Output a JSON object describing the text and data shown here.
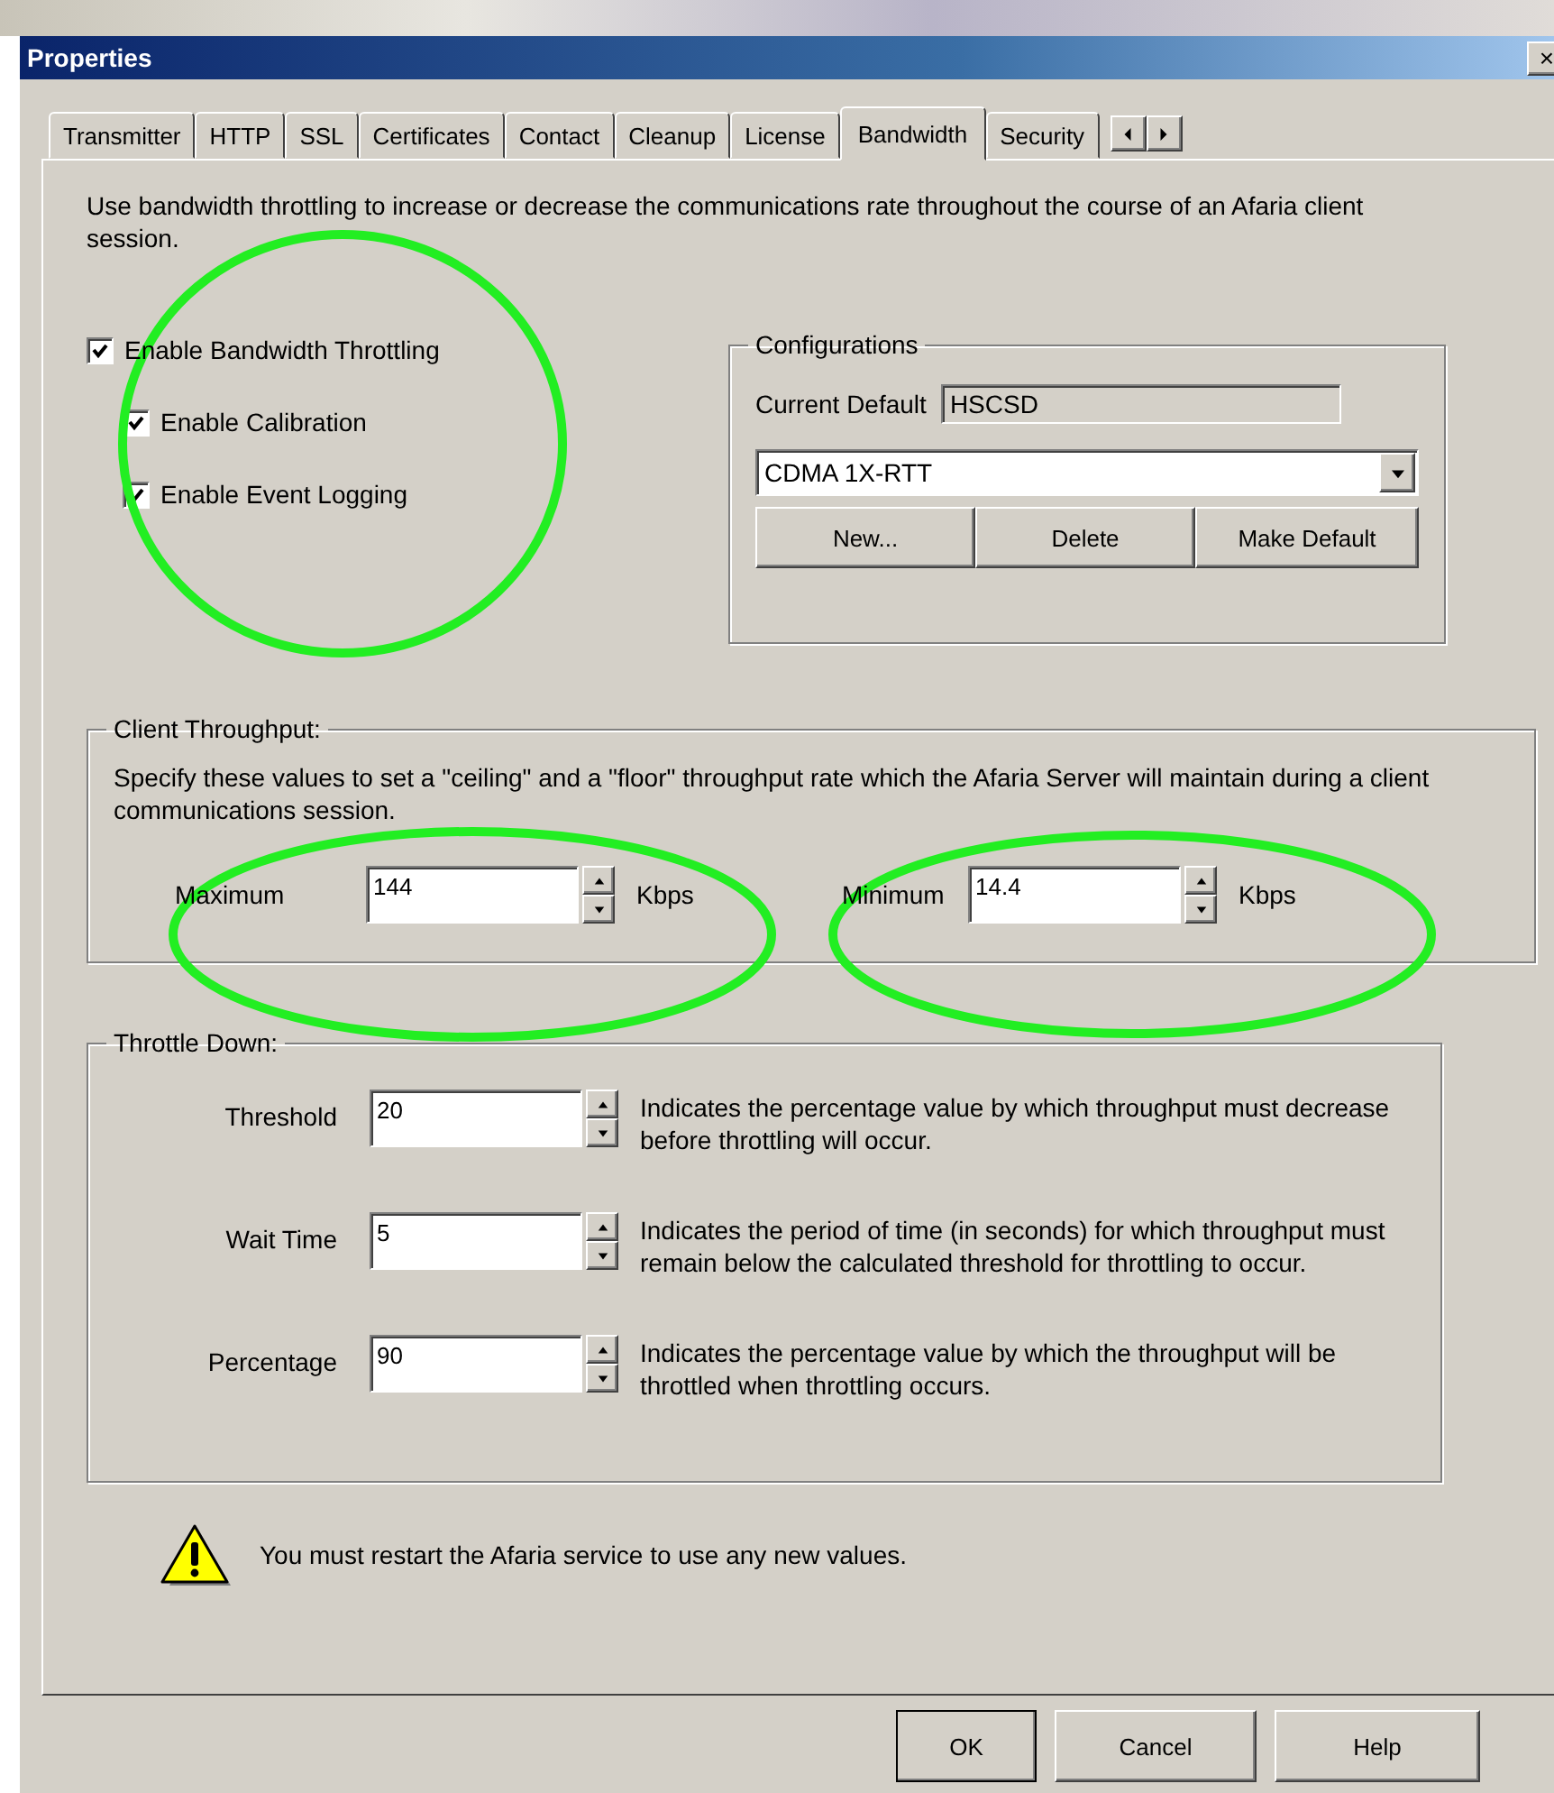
{
  "window": {
    "title": "Properties",
    "close": "×"
  },
  "tabs": [
    {
      "label": "Transmitter",
      "selected": false
    },
    {
      "label": "HTTP",
      "selected": false
    },
    {
      "label": "SSL",
      "selected": false
    },
    {
      "label": "Certificates",
      "selected": false
    },
    {
      "label": "Contact",
      "selected": false
    },
    {
      "label": "Cleanup",
      "selected": false
    },
    {
      "label": "License",
      "selected": false
    },
    {
      "label": "Bandwidth",
      "selected": true
    },
    {
      "label": "Security",
      "selected": false
    }
  ],
  "description": "Use bandwidth throttling to increase or decrease the communications rate throughout the course of an Afaria client session.",
  "options": [
    {
      "label": "Enable Bandwidth Throttling",
      "checked": true,
      "children": [
        {
          "label": "Enable Calibration",
          "checked": true
        },
        {
          "label": "Enable Event Logging",
          "checked": true
        }
      ]
    }
  ],
  "configurations": {
    "title": "Configurations",
    "current_default_label": "Current Default",
    "current_default_value": "HSCSD",
    "selection": "CDMA 1X-RTT",
    "buttons": [
      "New...",
      "Delete",
      "Make Default"
    ]
  },
  "client_throughput": {
    "title": "Client Throughput:",
    "description": "Specify these values to set a \"ceiling\" and a \"floor\" throughput rate which the Afaria Server will maintain during a client communications session.",
    "fields": [
      {
        "label": "Maximum",
        "value": "144",
        "unit": "Kbps"
      },
      {
        "label": "Minimum",
        "value": "14.4",
        "unit": "Kbps"
      }
    ]
  },
  "throttle_down": {
    "title": "Throttle Down:",
    "fields": [
      {
        "label": "Threshold",
        "value": "20",
        "description": "Indicates the percentage value by which throughput must decrease before throttling will occur."
      },
      {
        "label": "Wait Time",
        "value": "5",
        "description": "Indicates the period of time (in seconds) for which throughput must remain below the calculated threshold for throttling to occur."
      },
      {
        "label": "Percentage",
        "value": "90",
        "description": "Indicates the percentage value by which the throughput will be throttled when throttling occurs."
      }
    ]
  },
  "warning": "You must restart the Afaria service to use any new values.",
  "buttons": [
    {
      "label": "OK",
      "default": true
    },
    {
      "label": "Cancel",
      "default": false
    },
    {
      "label": "Help",
      "default": false
    }
  ]
}
